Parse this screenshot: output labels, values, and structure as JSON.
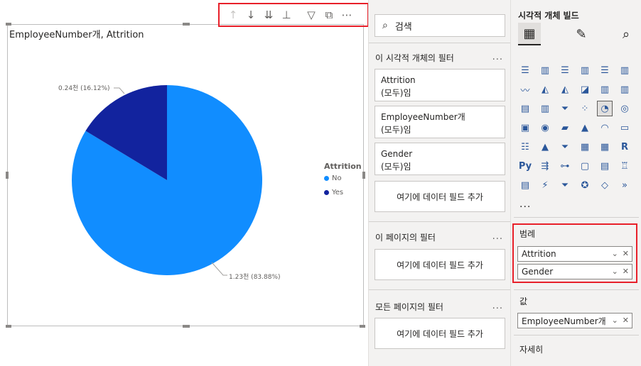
{
  "visual": {
    "title": "EmployeeNumber개, Attrition",
    "toolbar": {
      "icons": [
        "arrow-up-icon",
        "arrow-down-icon",
        "double-arrow-down-icon",
        "expand-hierarchy-icon",
        "filter-icon",
        "focus-mode-icon",
        "more-options-icon"
      ]
    }
  },
  "chart_data": {
    "type": "pie",
    "categories": [
      "No",
      "Yes"
    ],
    "values": [
      1.23,
      0.24
    ],
    "percentages": [
      83.88,
      16.12
    ],
    "data_labels": [
      "1.23천 (83.88%)",
      "0.24천 (16.12%)"
    ],
    "colors": [
      "#118dff",
      "#12239e"
    ],
    "legend": {
      "title": "Attrition",
      "items": [
        "No",
        "Yes"
      ],
      "placement": "right"
    }
  },
  "filters_pane": {
    "search_placeholder": "검색",
    "visual_filters_header": "이 시각적 개체의 필터",
    "visual_filters": [
      {
        "field": "Attrition",
        "state": "(모두)임"
      },
      {
        "field": "EmployeeNumber개",
        "state": "(모두)임"
      },
      {
        "field": "Gender",
        "state": "(모두)임"
      }
    ],
    "add_field_label": "여기에 데이터 필드 추가",
    "page_filters_header": "이 페이지의 필터",
    "all_pages_filters_header": "모든 페이지의 필터",
    "more": "..."
  },
  "viz_pane": {
    "title": "시각적 개체 빌드",
    "more": "...",
    "legend_well": {
      "label": "범례",
      "fields": [
        "Attrition",
        "Gender"
      ]
    },
    "values_well": {
      "label": "값",
      "fields": [
        "EmployeeNumber개"
      ]
    },
    "details_well": {
      "label": "자세히"
    }
  }
}
